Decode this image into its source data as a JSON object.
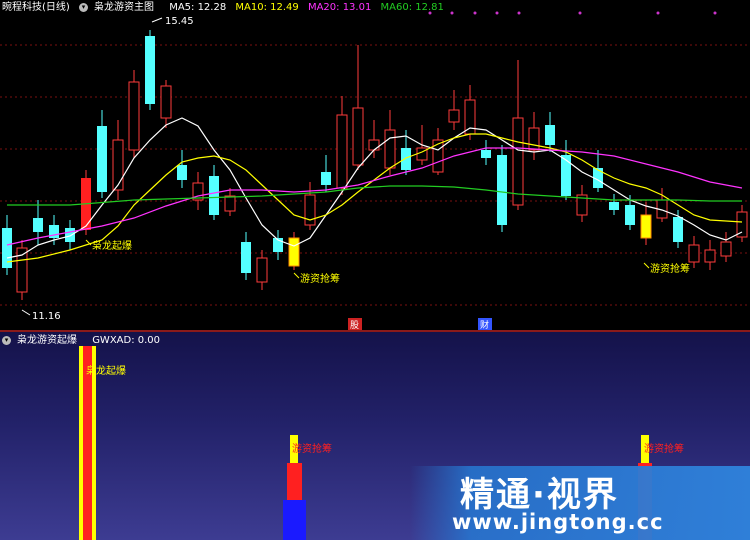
{
  "header": {
    "stock": "晼程科技(日线)",
    "indicator": "枭龙游资主图",
    "ma": [
      {
        "label": "MA5: 12.28",
        "color": "#ffffff"
      },
      {
        "label": "MA10: 12.49",
        "color": "#ffff00"
      },
      {
        "label": "MA20: 13.01",
        "color": "#ff33ff"
      },
      {
        "label": "MA60: 12.81",
        "color": "#22cc22"
      }
    ]
  },
  "main": {
    "high_label": "15.45",
    "low_label": "11.16",
    "markers": {
      "m1": "枭龙起爆",
      "m2": "游资抢筹",
      "m3": "游资抢筹"
    },
    "tags": {
      "t1": "股",
      "t2": "财"
    }
  },
  "sub": {
    "title": "枭龙游资起爆",
    "value": "GWXAD: 0.00",
    "bar_labels": {
      "b1": "枭龙起爆",
      "b2": "游资抢筹",
      "b3": "游资抢筹"
    }
  },
  "watermark": {
    "line1": "精通·视界",
    "line2": "www.jingtong.cc"
  },
  "colors": {
    "up": "#ff3b3b",
    "down": "#54ffff",
    "ma5": "#ffffff",
    "ma10": "#ffff00",
    "ma20": "#ff33ff",
    "ma60": "#22cc22"
  }
}
